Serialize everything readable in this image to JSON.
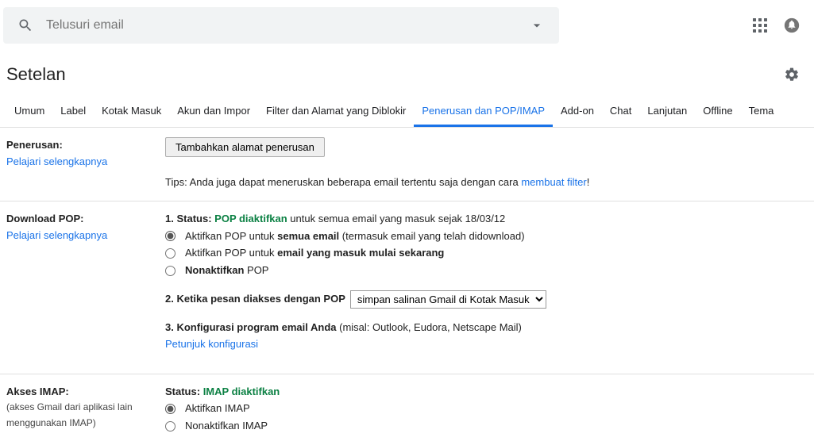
{
  "search": {
    "placeholder": "Telusuri email"
  },
  "page_title": "Setelan",
  "tabs": [
    "Umum",
    "Label",
    "Kotak Masuk",
    "Akun dan Impor",
    "Filter dan Alamat yang Diblokir",
    "Penerusan dan POP/IMAP",
    "Add-on",
    "Chat",
    "Lanjutan",
    "Offline",
    "Tema"
  ],
  "forward": {
    "title": "Penerusan:",
    "learn_more": "Pelajari selengkapnya",
    "button": "Tambahkan alamat penerusan",
    "tips_prefix": "Tips: Anda juga dapat meneruskan beberapa email tertentu saja dengan cara ",
    "tips_link": "membuat filter",
    "tips_suffix": "!"
  },
  "pop": {
    "title": "Download POP:",
    "learn_more": "Pelajari selengkapnya",
    "l1_num": "1. ",
    "status_label": "Status:",
    "status_value": "POP diaktifkan",
    "status_rest": " untuk semua email yang masuk sejak 18/03/12",
    "r1a": "Aktifkan POP untuk ",
    "r1b": "semua email",
    "r1c": " (termasuk email yang telah didownload)",
    "r2a": "Aktifkan POP untuk ",
    "r2b": "email yang masuk mulai sekarang",
    "r3a": "Nonaktifkan",
    "r3b": " POP",
    "l2": "2. Ketika pesan diakses dengan POP",
    "select": "simpan salinan Gmail di Kotak Masuk",
    "l3a": "3. Konfigurasi program email Anda",
    "l3b": " (misal: Outlook, Eudora, Netscape Mail)",
    "l3link": "Petunjuk konfigurasi"
  },
  "imap": {
    "title": "Akses IMAP:",
    "sub": "(akses Gmail dari aplikasi lain menggunakan IMAP)",
    "status_label": "Status:",
    "status_value": "IMAP diaktifkan",
    "r1": "Aktifkan IMAP",
    "r2": "Nonaktifkan IMAP"
  }
}
